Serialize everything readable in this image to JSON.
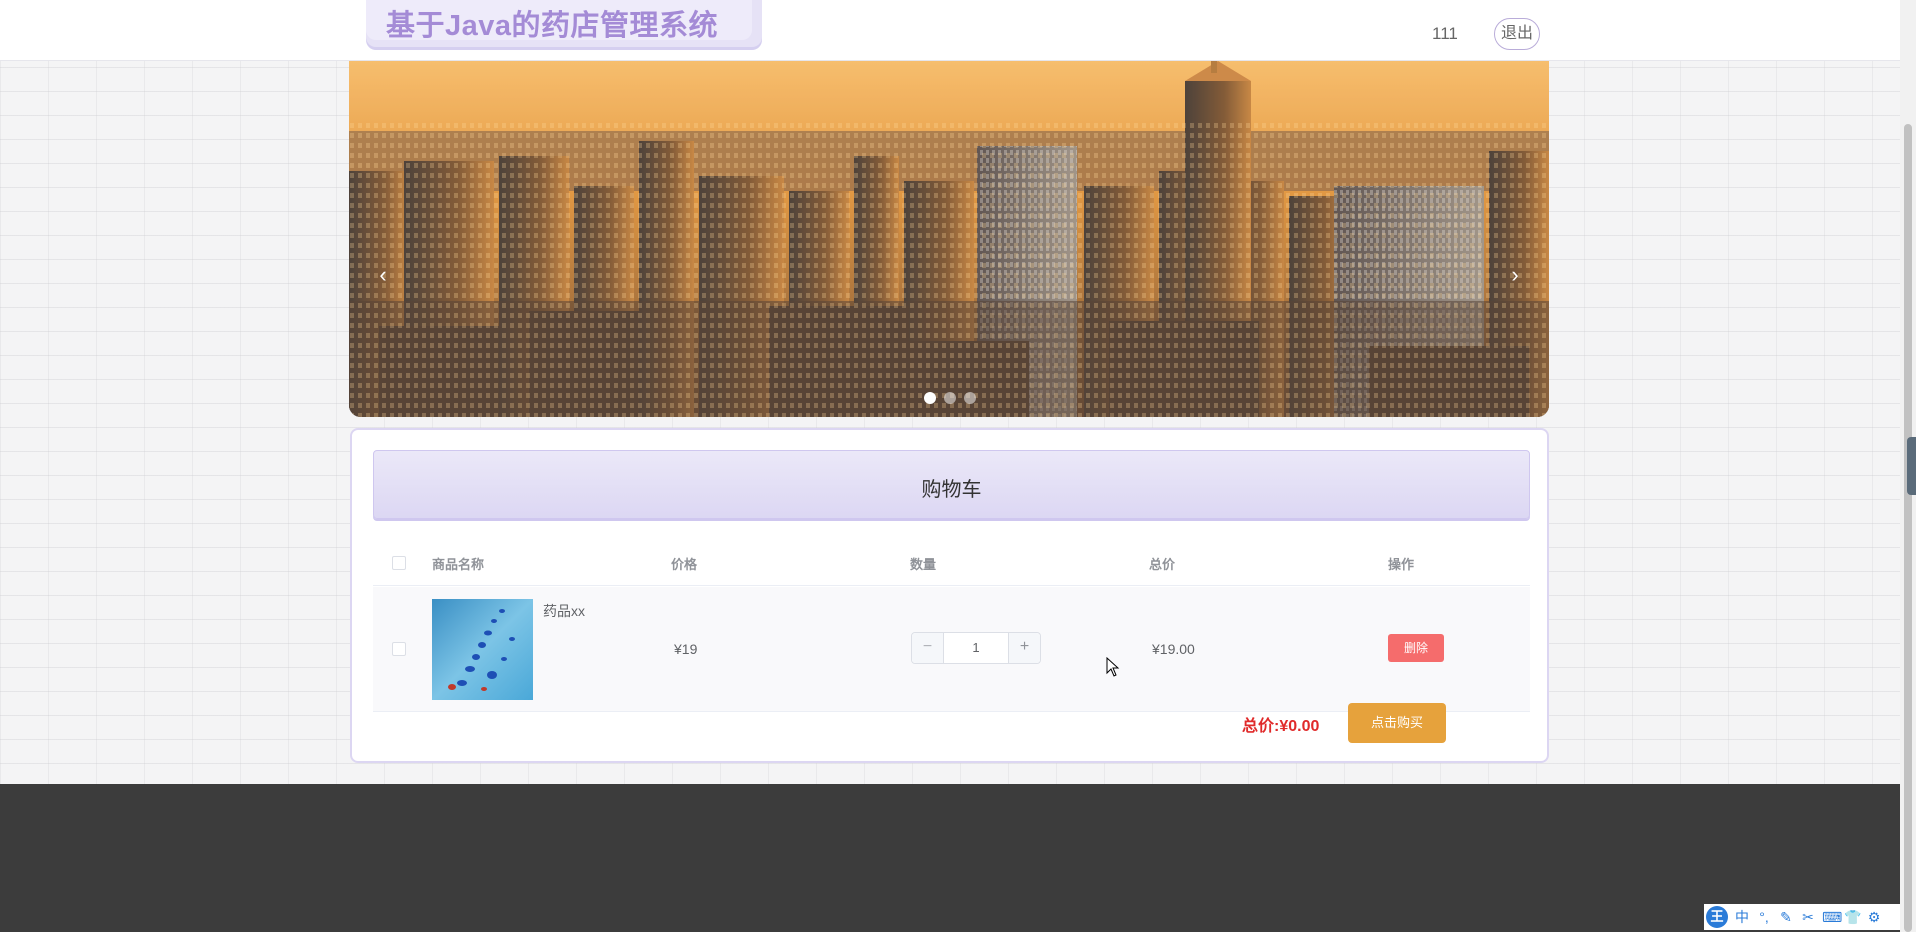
{
  "header": {
    "site_title": "基于Java的药店管理系统",
    "username": "111",
    "logout_label": "退出"
  },
  "carousel": {
    "prev_arrow": "‹",
    "next_arrow": "›",
    "slide_count": 3,
    "active_index": 0
  },
  "cart": {
    "title": "购物车",
    "columns": [
      "商品名称",
      "价格",
      "数量",
      "总价",
      "操作"
    ],
    "items": [
      {
        "name": "药品xx",
        "price": "¥19",
        "quantity": "1",
        "subtotal": "¥19.00",
        "delete_label": "删除",
        "checked": false
      }
    ],
    "total_label": "总价:",
    "total_value": "¥0.00",
    "buy_label": "点击购买"
  },
  "stepper": {
    "minus": "−",
    "plus": "+"
  },
  "ime_toolbar": {
    "logo": "王",
    "items": [
      "中",
      "°,",
      "✎",
      "✂",
      "⌨",
      "👕",
      "⚙"
    ]
  },
  "colors": {
    "title": "#a48bd6",
    "accent_purple": "#dcd7f3",
    "delete": "#f56c6c",
    "buy": "#e6a23c",
    "total": "#e02a2a",
    "footer": "#3c3c3c"
  }
}
